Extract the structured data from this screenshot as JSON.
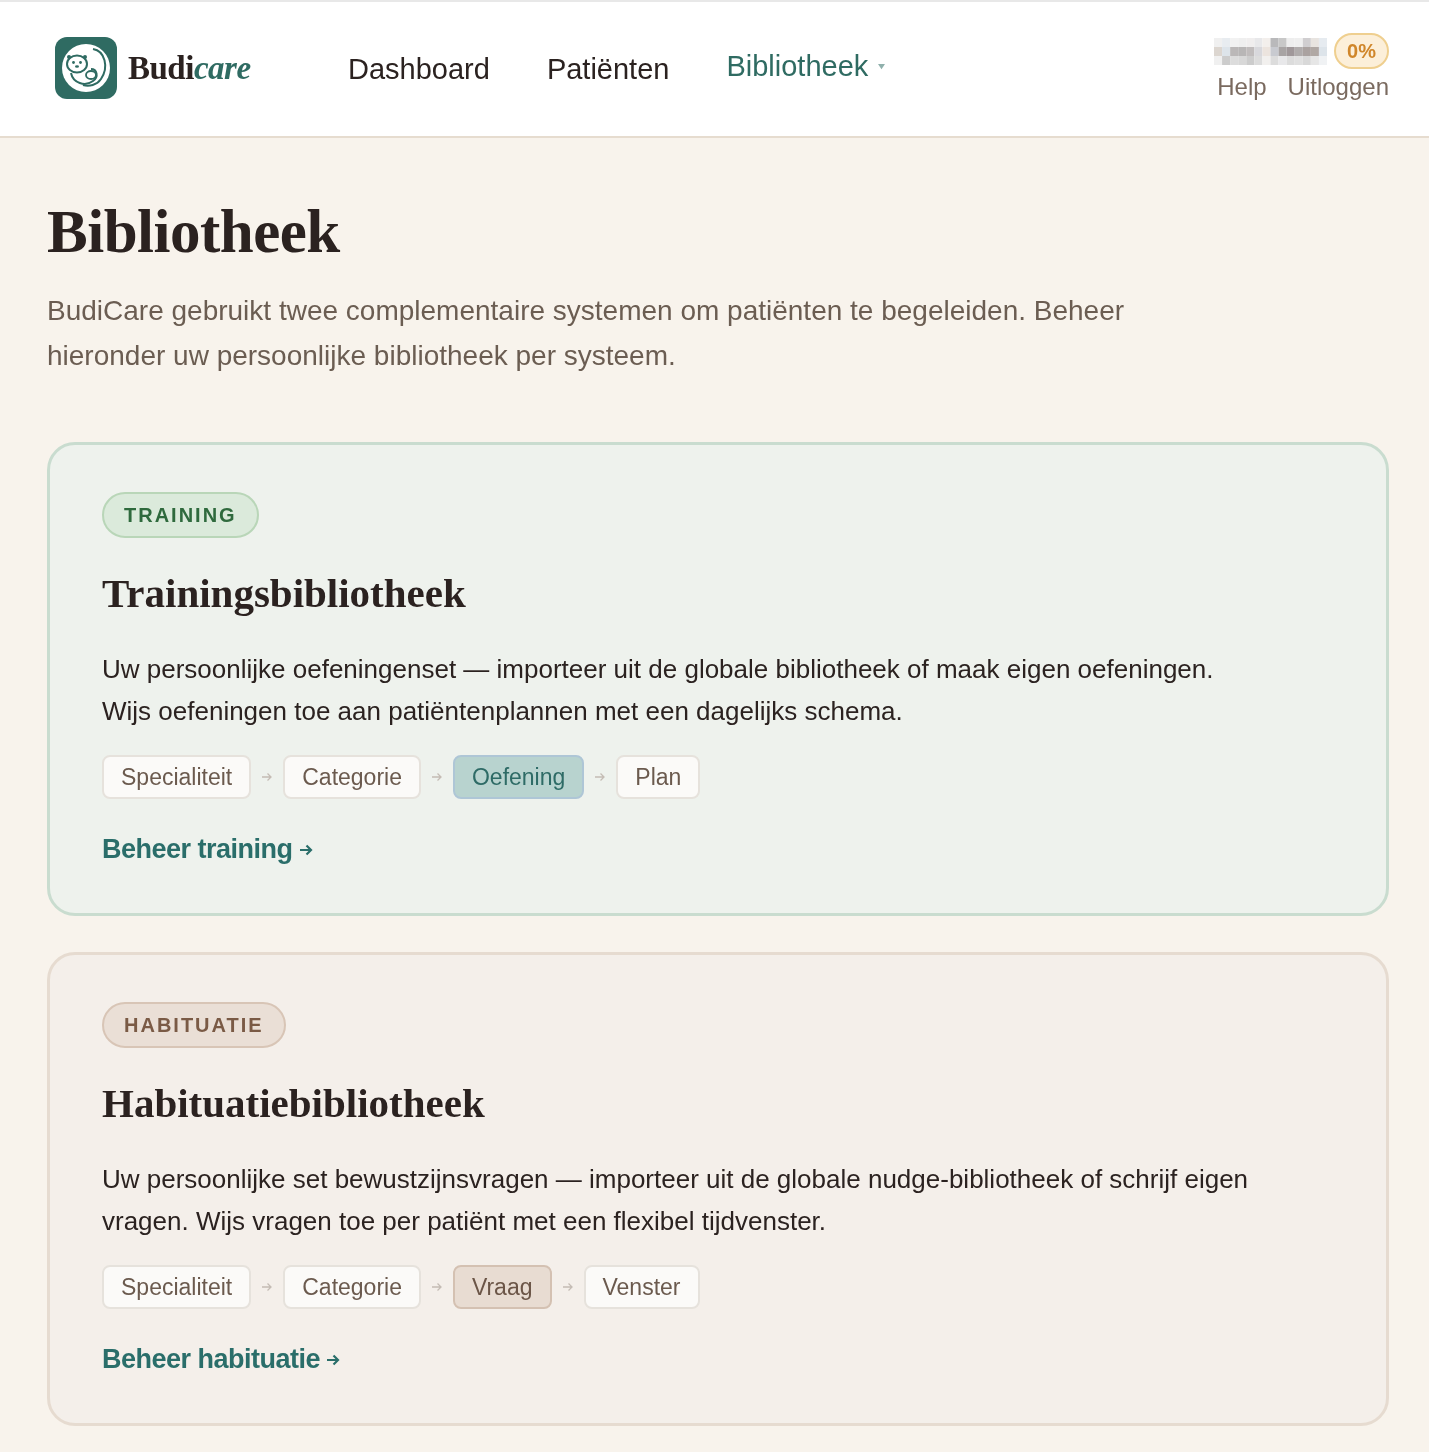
{
  "header": {
    "logo": {
      "name": "Budi",
      "accent": "care"
    },
    "nav": [
      {
        "label": "Dashboard",
        "selected": false,
        "has_menu": false
      },
      {
        "label": "Patiënten",
        "selected": false,
        "has_menu": false
      },
      {
        "label": "Bibliotheek",
        "selected": true,
        "has_menu": true
      }
    ],
    "user": {
      "progress_badge": "0%",
      "links": [
        "Help",
        "Uitloggen"
      ]
    }
  },
  "page": {
    "title": "Bibliotheek",
    "intro": "BudiCare gebruikt twee complementaire systemen om patiënten te begeleiden. Beheer hieronder uw persoonlijke bibliotheek per systeem."
  },
  "cards": [
    {
      "kind": "training",
      "tag": "TRAINING",
      "title": "Trainingsbibliotheek",
      "description": "Uw persoonlijke oefeningenset — importeer uit de globale bibliotheek of maak eigen oefeningen. Wijs oefeningen toe aan patiëntenplannen met een dagelijks schema.",
      "steps": [
        {
          "label": "Specialiteit",
          "selected": false
        },
        {
          "label": "Categorie",
          "selected": false
        },
        {
          "label": "Oefening",
          "selected": true
        },
        {
          "label": "Plan",
          "selected": false
        }
      ],
      "link": "Beheer training"
    },
    {
      "kind": "habituation",
      "tag": "HABITUATIE",
      "title": "Habituatiebibliotheek",
      "description": "Uw persoonlijke set bewustzijnsvragen — importeer uit de globale nudge-bibliotheek of schrijf eigen vragen. Wijs vragen toe per patiënt met een flexibel tijdvenster.",
      "steps": [
        {
          "label": "Specialiteit",
          "selected": false
        },
        {
          "label": "Categorie",
          "selected": false
        },
        {
          "label": "Vraag",
          "selected": true
        },
        {
          "label": "Venster",
          "selected": false
        }
      ],
      "link": "Beheer habituatie"
    }
  ]
}
